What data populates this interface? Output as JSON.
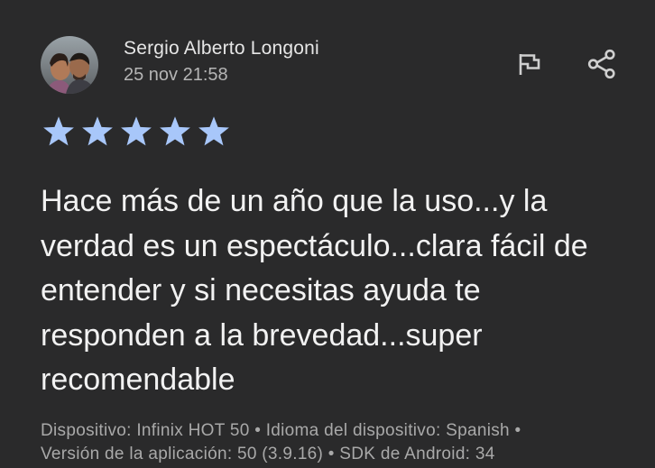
{
  "review": {
    "author": "Sergio Alberto Longoni",
    "date": "25 nov 21:58",
    "rating": 5,
    "max_rating": 5,
    "text": "Hace más de un año que la uso...y la verdad es un espectáculo...clara fácil de entender y si necesitas ayuda te responden a la brevedad...super recomendable",
    "device_line_1": "Dispositivo: Infinix HOT 50 • Idioma del dispositivo: Spanish •",
    "device_line_2": "Versión de la aplicación: 50 (3.9.16) • SDK de Android: 34"
  },
  "icons": {
    "flag": "flag-icon",
    "share": "share-icon",
    "star": "star-icon"
  },
  "colors": {
    "background": "#2a2a2b",
    "star": "#a8c7fa",
    "text_primary": "#f2f2f2",
    "text_secondary": "#a9a9a9"
  }
}
